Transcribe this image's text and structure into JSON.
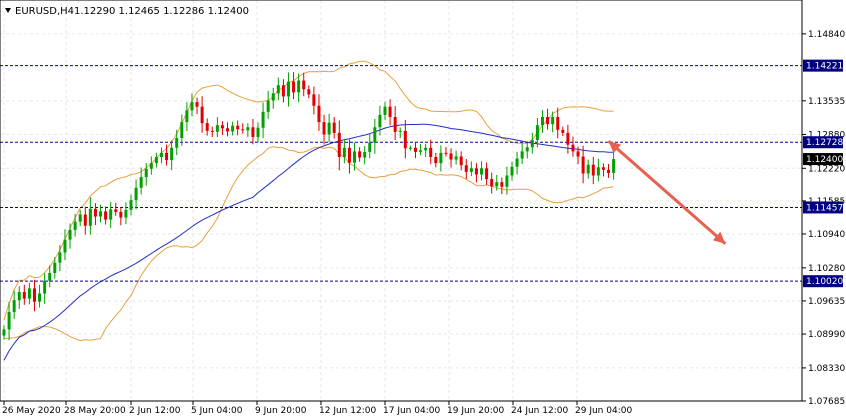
{
  "header": {
    "symbol": "EURUSD,H4",
    "ohlc": "1.12290 1.12465 1.12286 1.12400"
  },
  "colors": {
    "bull": "#00a000",
    "bear": "#e00000",
    "upper_band": "#e8a040",
    "lower_band": "#e8a040",
    "ma": "#2030c0",
    "level_line": "#000090",
    "level_box": "#000080",
    "arrow": "#e86050",
    "grid": "#e6e6e6",
    "axis": "#000000"
  },
  "icons": {
    "header_menu": "triangle-down-icon",
    "price_arrow": "down-right-arrow-icon"
  },
  "chart_data": {
    "type": "candlestick",
    "title": "EURUSD,H4",
    "ylim": [
      1.07685,
      1.155
    ],
    "y_ticks": [
      "1.14840",
      "1.13535",
      "1.12880",
      "1.12220",
      "1.11585",
      "1.10940",
      "1.10280",
      "1.09635",
      "1.08990",
      "1.08330",
      "1.07685"
    ],
    "x_ticks": [
      "26 May 2020",
      "28 May 20:00",
      "2 Jun 12:00",
      "5 Jun 04:00",
      "9 Jun 20:00",
      "12 Jun 12:00",
      "17 Jun 04:00",
      "19 Jun 20:00",
      "24 Jun 12:00",
      "29 Jun 04:00"
    ],
    "grid": true,
    "levels": [
      {
        "name": "resistance-1",
        "value": 1.14221,
        "label": "1.14221"
      },
      {
        "name": "resistance-2",
        "value": 1.12728,
        "label": "1.12728"
      },
      {
        "name": "support-1",
        "value": 1.11457,
        "label": "1.11457"
      },
      {
        "name": "support-2",
        "value": 1.1002,
        "label": "1.10020"
      }
    ],
    "current_price": {
      "value": 1.124,
      "label": "1.12400"
    },
    "projection_arrow": {
      "from": {
        "bar": 119,
        "price": 1.1275
      },
      "to": {
        "bar": 142,
        "price": 1.1075
      }
    },
    "closes": [
      1.0908,
      1.0942,
      1.0965,
      1.0981,
      1.0968,
      1.0988,
      1.0962,
      1.0978,
      1.1003,
      1.1018,
      1.1038,
      1.1058,
      1.1083,
      1.1102,
      1.1118,
      1.1132,
      1.111,
      1.1143,
      1.1128,
      1.1138,
      1.1122,
      1.1142,
      1.1137,
      1.1126,
      1.1141,
      1.116,
      1.1184,
      1.1205,
      1.1221,
      1.1232,
      1.1244,
      1.1252,
      1.1238,
      1.1262,
      1.1281,
      1.1312,
      1.1335,
      1.1351,
      1.1342,
      1.131,
      1.1295,
      1.1293,
      1.1306,
      1.13,
      1.1294,
      1.1305,
      1.1298,
      1.1296,
      1.1302,
      1.1283,
      1.1301,
      1.1332,
      1.1354,
      1.1368,
      1.1384,
      1.1362,
      1.1391,
      1.137,
      1.1393,
      1.1376,
      1.1366,
      1.1344,
      1.1312,
      1.1288,
      1.1311,
      1.1291,
      1.1244,
      1.1262,
      1.1233,
      1.1255,
      1.1243,
      1.1254,
      1.1272,
      1.1302,
      1.1326,
      1.1342,
      1.1322,
      1.1293,
      1.1295,
      1.1261,
      1.1262,
      1.1254,
      1.1257,
      1.1262,
      1.1244,
      1.1232,
      1.1252,
      1.1251,
      1.1239,
      1.1245,
      1.1228,
      1.1215,
      1.1222,
      1.121,
      1.1222,
      1.1201,
      1.1187,
      1.1195,
      1.1186,
      1.1208,
      1.1225,
      1.1241,
      1.1255,
      1.1263,
      1.1277,
      1.1306,
      1.1322,
      1.1308,
      1.1322,
      1.1297,
      1.1291,
      1.1268,
      1.1255,
      1.1245,
      1.1212,
      1.1229,
      1.1208,
      1.1224,
      1.1219,
      1.1213,
      1.124
    ]
  }
}
